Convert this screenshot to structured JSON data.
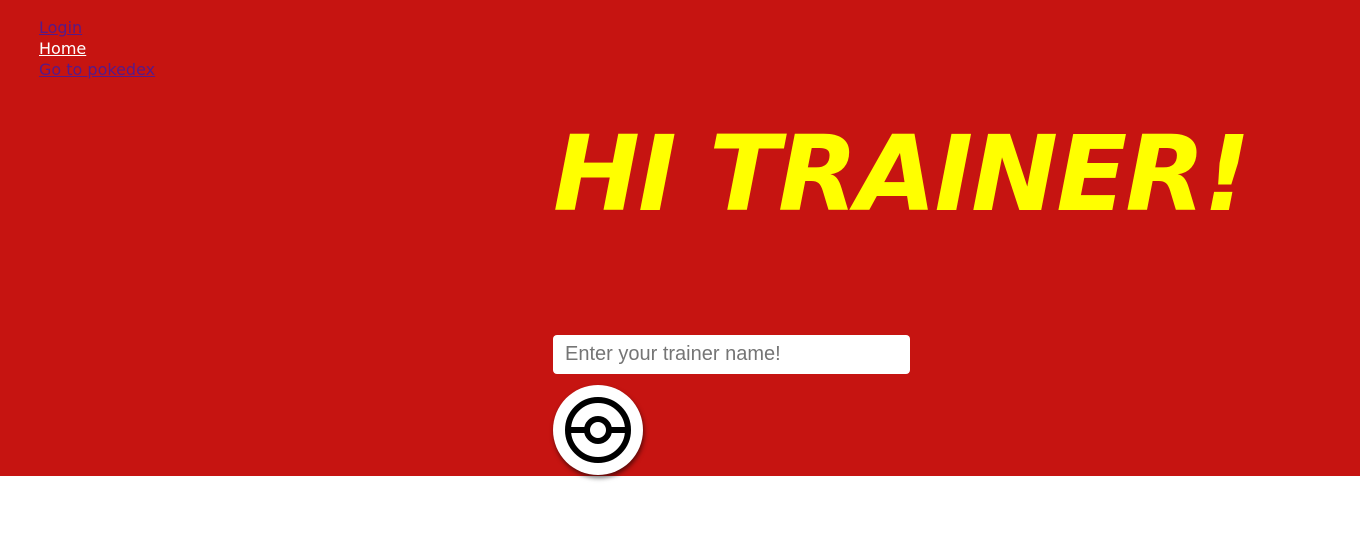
{
  "nav": {
    "items": [
      {
        "label": "Login",
        "state": "visited"
      },
      {
        "label": "Home",
        "state": "active"
      },
      {
        "label": "Go to pokedex",
        "state": "visited"
      }
    ]
  },
  "hero": {
    "title": "HI TRAINER!",
    "background_color": "#c61411",
    "title_color": "#ffff00"
  },
  "form": {
    "name_placeholder": "Enter your trainer name!",
    "name_value": "",
    "submit_icon": "pokeball-icon"
  }
}
